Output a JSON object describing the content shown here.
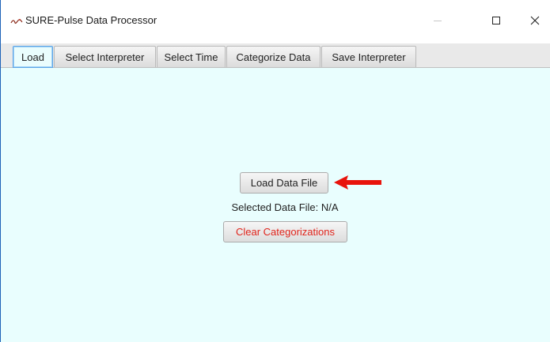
{
  "window": {
    "title": "SURE-Pulse Data Processor",
    "app_icon": "app-logo-icon",
    "controls": {
      "minimize_icon": "minimize-icon",
      "maximize_icon": "maximize-icon",
      "close_glyph": "✕",
      "close_icon": "close-icon"
    }
  },
  "tabs": [
    {
      "label": "Load",
      "active": true
    },
    {
      "label": "Select Interpreter",
      "active": false
    },
    {
      "label": "Select Time",
      "active": false
    },
    {
      "label": "Categorize Data",
      "active": false
    },
    {
      "label": "Save Interpreter",
      "active": false
    }
  ],
  "load_panel": {
    "load_button_label": "Load Data File",
    "selected_file_text": "Selected Data File: N/A",
    "clear_button_label": "Clear Categorizations",
    "annotation_arrow_icon": "left-arrow-icon"
  },
  "colors": {
    "panel_background": "#e9fefe",
    "clear_button_text": "#e0241b",
    "annotation_arrow": "#e8140c",
    "active_tab_border": "#5da6e8"
  }
}
